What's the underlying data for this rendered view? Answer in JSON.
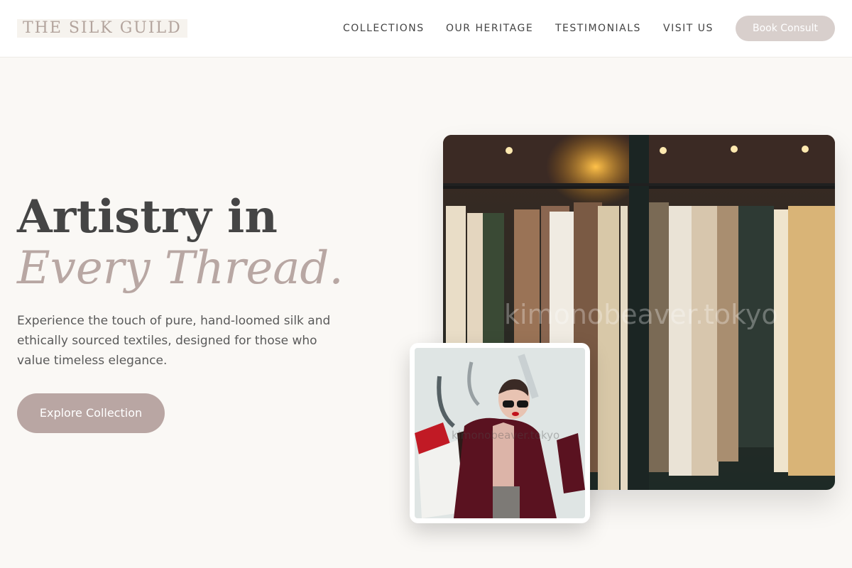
{
  "header": {
    "logo": "THE SILK GUILD",
    "nav": [
      "COLLECTIONS",
      "OUR HERITAGE",
      "TESTIMONIALS",
      "VISIT US"
    ],
    "cta": "Book Consult"
  },
  "hero": {
    "title_line1": "Artistry in",
    "title_line2": "Every Thread.",
    "description": "Experience the touch of pure, hand-loomed silk and ethically sourced textiles, designed for those who value timeless elegance.",
    "cta": "Explore Collection"
  },
  "images": {
    "main_watermark": "kimonobeaver.tokyo",
    "small_watermark": "kimonobeaver.tokyo"
  },
  "colors": {
    "accent": "#b9a6a3",
    "button_light": "#d8cfcc",
    "background": "#faf8f5"
  }
}
